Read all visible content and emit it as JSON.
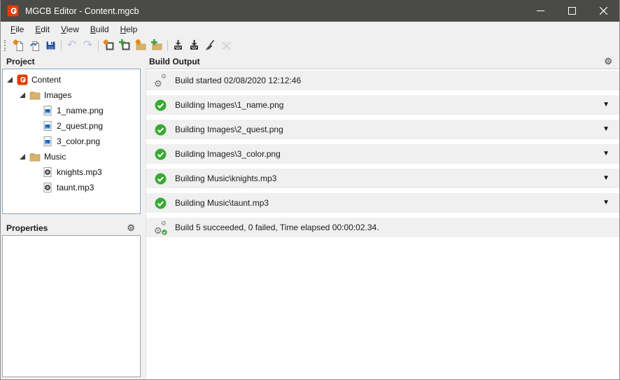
{
  "window": {
    "title": "MGCB Editor - Content.mgcb",
    "controls": {
      "minimize": "minimize",
      "maximize": "maximize",
      "close": "close"
    }
  },
  "menu": {
    "items": [
      "File",
      "Edit",
      "View",
      "Build",
      "Help"
    ]
  },
  "toolbar": {
    "buttons": [
      {
        "name": "new-project",
        "enabled": true
      },
      {
        "name": "open-project",
        "enabled": true
      },
      {
        "name": "save-project",
        "enabled": true
      },
      {
        "name": "undo",
        "enabled": false
      },
      {
        "name": "redo",
        "enabled": false
      },
      {
        "name": "new-item",
        "enabled": true
      },
      {
        "name": "add-existing-item",
        "enabled": true
      },
      {
        "name": "new-folder",
        "enabled": true
      },
      {
        "name": "add-existing-folder",
        "enabled": true
      },
      {
        "name": "build",
        "enabled": true
      },
      {
        "name": "rebuild",
        "enabled": true
      },
      {
        "name": "clean",
        "enabled": true
      },
      {
        "name": "cancel-build",
        "enabled": false
      }
    ]
  },
  "panels": {
    "project_header": "Project",
    "properties_header": "Properties",
    "build_output_header": "Build Output"
  },
  "tree": {
    "items": [
      {
        "label": "Content",
        "icon": "monogame-logo",
        "level": 0,
        "expanded": true
      },
      {
        "label": "Images",
        "icon": "folder",
        "level": 1,
        "expanded": true
      },
      {
        "label": "1_name.png",
        "icon": "image-file",
        "level": 2
      },
      {
        "label": "2_quest.png",
        "icon": "image-file",
        "level": 2
      },
      {
        "label": "3_color.png",
        "icon": "image-file",
        "level": 2
      },
      {
        "label": "Music",
        "icon": "folder",
        "level": 1,
        "expanded": true
      },
      {
        "label": "knights.mp3",
        "icon": "audio-file",
        "level": 2
      },
      {
        "label": "taunt.mp3",
        "icon": "audio-file",
        "level": 2
      }
    ]
  },
  "build_output": {
    "rows": [
      {
        "icon": "gears",
        "text": "Build started 02/08/2020 12:12:46",
        "expandable": false
      },
      {
        "icon": "success-check",
        "text": "Building Images\\1_name.png",
        "expandable": true
      },
      {
        "icon": "success-check",
        "text": "Building Images\\2_quest.png",
        "expandable": true
      },
      {
        "icon": "success-check",
        "text": "Building Images\\3_color.png",
        "expandable": true
      },
      {
        "icon": "success-check",
        "text": "Building Music\\knights.mp3",
        "expandable": true
      },
      {
        "icon": "success-check",
        "text": "Building Music\\taunt.mp3",
        "expandable": true
      },
      {
        "icon": "gears-success",
        "text": "Build 5 succeeded, 0 failed, Time elapsed 00:00:02.34.",
        "expandable": false
      }
    ]
  },
  "icons": {
    "gear": "⚙",
    "caret_down": "▼",
    "undo": "↶",
    "redo": "↷"
  },
  "colors": {
    "titlebar": "#4a4a47",
    "accent_orange": "#e73b00",
    "success_green": "#39a935",
    "panel_bg": "#f0f0f0",
    "tree_border": "#86a5c5"
  }
}
